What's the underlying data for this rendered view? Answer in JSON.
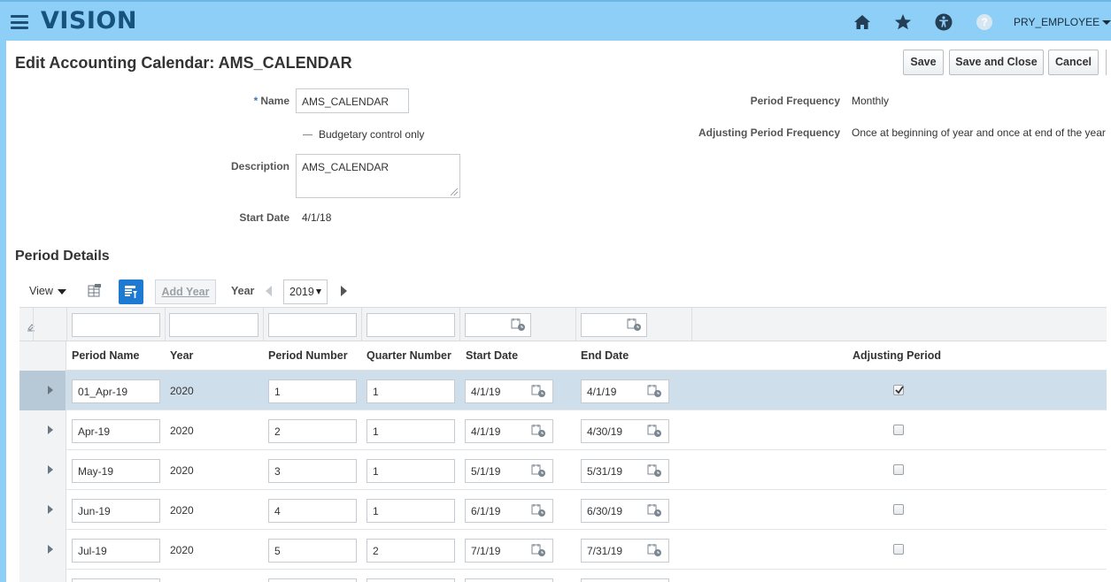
{
  "header": {
    "logo": "VISION",
    "user": "PRY_EMPLOYEE"
  },
  "page": {
    "title": "Edit Accounting Calendar: AMS_CALENDAR",
    "buttons": {
      "save": "Save",
      "save_and_close": "Save and Close",
      "cancel": "Cancel"
    }
  },
  "form": {
    "name_label": "Name",
    "name_required": "*",
    "name_value": "AMS_CALENDAR",
    "budgetary_label": "Budgetary control only",
    "description_label": "Description",
    "description_value": "AMS_CALENDAR",
    "start_date_label": "Start Date",
    "start_date_value": "4/1/18",
    "period_frequency_label": "Period Frequency",
    "period_frequency_value": "Monthly",
    "adjusting_period_frequency_label": "Adjusting Period Frequency",
    "adjusting_period_frequency_value": "Once at beginning of year and once at end of the year"
  },
  "section": {
    "title": "Period Details"
  },
  "toolbar": {
    "view_label": "View",
    "add_year": "Add Year",
    "year_label": "Year",
    "year_value": "2019"
  },
  "table": {
    "columns": [
      "Period Name",
      "Year",
      "Period Number",
      "Quarter Number",
      "Start Date",
      "End Date",
      "Adjusting Period"
    ],
    "rows": [
      {
        "period_name": "01_Apr-19",
        "year": "2020",
        "period_number": "1",
        "quarter_number": "1",
        "start_date": "4/1/19",
        "end_date": "4/1/19",
        "adjusting": true,
        "selected": true
      },
      {
        "period_name": "Apr-19",
        "year": "2020",
        "period_number": "2",
        "quarter_number": "1",
        "start_date": "4/1/19",
        "end_date": "4/30/19",
        "adjusting": false,
        "selected": false
      },
      {
        "period_name": "May-19",
        "year": "2020",
        "period_number": "3",
        "quarter_number": "1",
        "start_date": "5/1/19",
        "end_date": "5/31/19",
        "adjusting": false,
        "selected": false
      },
      {
        "period_name": "Jun-19",
        "year": "2020",
        "period_number": "4",
        "quarter_number": "1",
        "start_date": "6/1/19",
        "end_date": "6/30/19",
        "adjusting": false,
        "selected": false
      },
      {
        "period_name": "Jul-19",
        "year": "2020",
        "period_number": "5",
        "quarter_number": "2",
        "start_date": "7/1/19",
        "end_date": "7/31/19",
        "adjusting": false,
        "selected": false
      }
    ]
  },
  "colors": {
    "header_bg": "#8dcff6",
    "logo": "#17517e",
    "selected_row": "#cfdeeb",
    "accent_button": "#1d7ad3"
  }
}
